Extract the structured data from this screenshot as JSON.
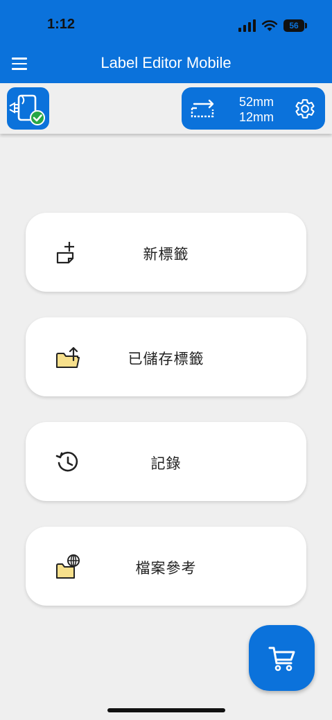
{
  "status_bar": {
    "time": "1:12",
    "battery": "56"
  },
  "appbar": {
    "title": "Label Editor Mobile"
  },
  "toolbar": {
    "label_width": "52mm",
    "label_height": "12mm"
  },
  "menu_items": [
    {
      "label": "新標籤",
      "icon": "new-label-icon"
    },
    {
      "label": "已儲存標籤",
      "icon": "upload-folder-icon"
    },
    {
      "label": "記錄",
      "icon": "history-icon"
    },
    {
      "label": "檔案參考",
      "icon": "web-folder-icon"
    }
  ],
  "colors": {
    "primary": "#0b72db",
    "background": "#efefef",
    "folder": "#f7e08c",
    "check": "#27a745"
  }
}
